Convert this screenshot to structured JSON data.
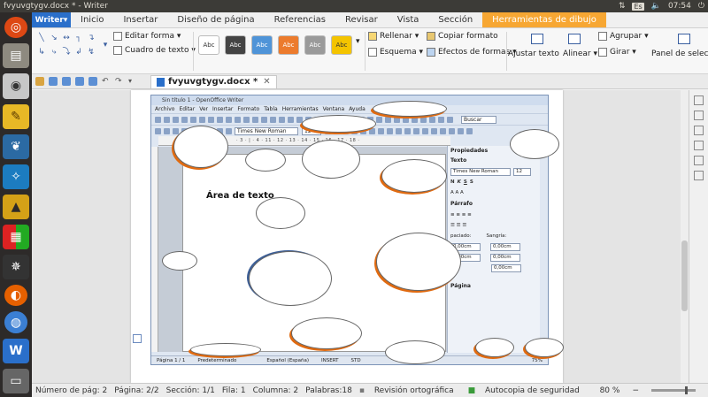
{
  "system": {
    "window_title": "fvyuvgtygv.docx * - Writer",
    "keyboard": "Es",
    "time": "07:54"
  },
  "app": {
    "app_button": "Writer",
    "menu_tabs": [
      "Inicio",
      "Insertar",
      "Diseño de página",
      "Referencias",
      "Revisar",
      "Vista",
      "Sección",
      "Herramientas de dibujo"
    ],
    "accent_color": "#f7a733",
    "brand_color": "#2a6fca"
  },
  "ribbon": {
    "edit_shape": "Editar forma",
    "text_box": "Cuadro de texto",
    "style_label": "Abc",
    "styles": [
      {
        "bg": "#ffffff",
        "fg": "#333333"
      },
      {
        "bg": "#444444",
        "fg": "#ffffff"
      },
      {
        "bg": "#4f94d8",
        "fg": "#ffffff"
      },
      {
        "bg": "#ec7b2d",
        "fg": "#ffffff"
      },
      {
        "bg": "#9a9a9a",
        "fg": "#ffffff"
      },
      {
        "bg": "#f4c400",
        "fg": "#333333"
      }
    ],
    "fill": "Rellenar",
    "outline": "Esquema",
    "copy_format": "Copiar formato",
    "shape_effects": "Efectos de formas",
    "fit_text": "Ajustar texto",
    "align": "Alinear",
    "group": "Agrupar",
    "rotate": "Girar",
    "selection_pane": "Panel de selec"
  },
  "document": {
    "tab_name": "fvyuvgtygv.docx *",
    "embedded": {
      "title": "Sin título 1 - OpenOffice Writer",
      "menu": [
        "Archivo",
        "Editar",
        "Ver",
        "Insertar",
        "Formato",
        "Tabla",
        "Herramientas",
        "Ventana",
        "Ayuda"
      ],
      "font": "Times New Roman",
      "size": "12",
      "search": "Buscar",
      "ruler": "· 3 · | · 4 · 11 · 12 · 13 · 14 · 15 · 16 · 17 · 18 ·",
      "text_area": "Área de texto",
      "sidebar": {
        "title": "Propiedades",
        "text_section": "Texto",
        "font": "Times New Roman",
        "size": "12",
        "paragraph": "Párrafo",
        "spacing": "paciado:",
        "indent": "Sangría:",
        "value": "0,00cm",
        "page": "Página"
      },
      "status": {
        "page": "Página 1 / 1",
        "style": "Predeterminado",
        "lang": "Español (España)",
        "insert": "INSERT",
        "std": "STD",
        "zoom": "75%"
      }
    }
  },
  "statusbar": {
    "page_num": "Número de pág: 2",
    "pages": "Página: 2/2",
    "section": "Sección: 1/1",
    "row": "Fila: 1",
    "column": "Columna: 2",
    "words": "Palabras:18",
    "spell": "Revisión ortográfica",
    "autosave": "Autocopia de seguridad",
    "zoom": "80 %"
  }
}
